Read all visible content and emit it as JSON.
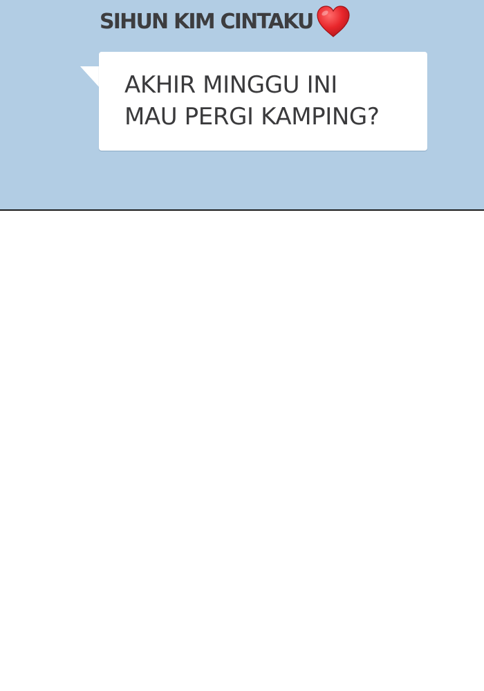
{
  "chat": {
    "sender_name": "SIHUN KIM CINTAKU",
    "sender_icon": "red-heart-icon",
    "message_lines": [
      "AKHIR MINGGU INI",
      "MAU PERGI KAMPING?"
    ]
  },
  "colors": {
    "chat_background": "#b2cde4",
    "bubble": "#ffffff",
    "text": "#3a3a3c",
    "heart": "#e8262b",
    "divider": "#1b1b1b",
    "page_background": "#ffffff"
  }
}
